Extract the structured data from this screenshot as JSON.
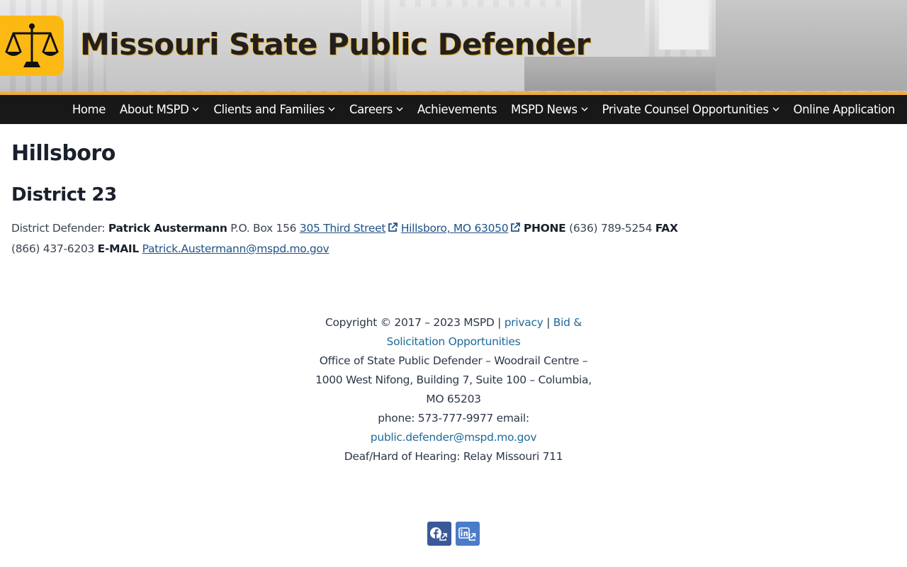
{
  "header": {
    "site_title": "Missouri State Public Defender",
    "logo_icon": "scales-of-justice-icon",
    "accent_color": "#fdb913"
  },
  "nav": {
    "items": [
      {
        "label": "Home",
        "has_dropdown": false
      },
      {
        "label": "About MSPD",
        "has_dropdown": true
      },
      {
        "label": "Clients and Families",
        "has_dropdown": true
      },
      {
        "label": "Careers",
        "has_dropdown": true
      },
      {
        "label": "Achievements",
        "has_dropdown": false
      },
      {
        "label": "MSPD News",
        "has_dropdown": true
      },
      {
        "label": "Private Counsel Opportunities",
        "has_dropdown": true
      },
      {
        "label": "Online Application",
        "has_dropdown": false
      }
    ]
  },
  "main": {
    "page_title": "Hillsboro",
    "district_heading": "District 23",
    "defender_label": "District Defender:",
    "defender_name": "Patrick Austermann",
    "po_box": "P.O. Box 156",
    "street_link": "305 Third Street",
    "city_link": "Hillsboro, MO 63050",
    "phone_label": "PHONE",
    "phone": "(636) 789-5254",
    "fax_label": "FAX",
    "fax": "(866) 437-6203",
    "email_label": "E-MAIL",
    "email": "Patrick.Austermann@mspd.mo.gov"
  },
  "footer": {
    "copyright": "Copyright © 2017 – 2023 MSPD |",
    "privacy_link": "privacy",
    "separator": "|",
    "bid_link": "Bid & Solicitation Opportunities",
    "office_line": "Office of State Public Defender – Woodrail Centre – 1000 West Nifong, Building 7, Suite 100 – Columbia, MO 65203",
    "phone_email_line": "phone: 573-777-9977 email:",
    "email_link": "public.defender@mspd.mo.gov",
    "relay_line": "Deaf/Hard of Hearing: Relay Missouri 711"
  },
  "social": [
    {
      "icon": "facebook-icon",
      "color": "#3b5998"
    },
    {
      "icon": "linkedin-icon",
      "color": "#4a7cc7"
    }
  ]
}
